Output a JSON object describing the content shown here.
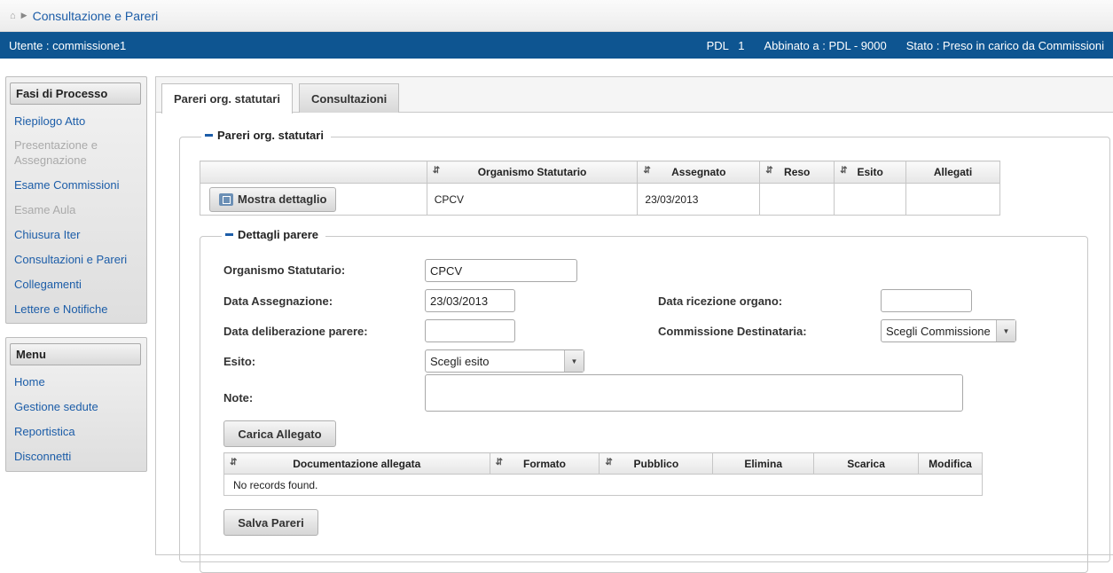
{
  "breadcrumb": {
    "current": "Consultazione e Pareri"
  },
  "userbar": {
    "user": "Utente : commissione1",
    "pdl": "PDL   1",
    "abbinato": "Abbinato a : PDL - 9000",
    "stato": "Stato : Preso in carico da Commissioni"
  },
  "fasi": {
    "title": "Fasi di Processo",
    "items": [
      {
        "label": "Riepilogo Atto"
      },
      {
        "label": "Presentazione e Assegnazione"
      },
      {
        "label": "Esame Commissioni"
      },
      {
        "label": "Esame Aula"
      },
      {
        "label": "Chiusura Iter"
      },
      {
        "label": "Consultazioni e Pareri"
      },
      {
        "label": "Collegamenti"
      },
      {
        "label": "Lettere e Notifiche"
      }
    ]
  },
  "menu": {
    "title": "Menu",
    "items": [
      {
        "label": "Home"
      },
      {
        "label": "Gestione sedute"
      },
      {
        "label": "Reportistica"
      },
      {
        "label": "Disconnetti"
      }
    ]
  },
  "tabs": [
    {
      "label": "Pareri org. statutari"
    },
    {
      "label": "Consultazioni"
    }
  ],
  "pareri": {
    "legend": "Pareri org. statutari",
    "columns": [
      "Organismo Statutario",
      "Assegnato",
      "Reso",
      "Esito",
      "Allegati"
    ],
    "row": {
      "button": "Mostra dettaglio",
      "organismo": "CPCV",
      "assegnato": "23/03/2013",
      "reso": "",
      "esito": "",
      "allegati": ""
    }
  },
  "dettagli": {
    "legend": "Dettagli parere",
    "organismo_label": "Organismo Statutario:",
    "organismo_value": "CPCV",
    "data_assegnazione_label": "Data Assegnazione:",
    "data_assegnazione_value": "23/03/2013",
    "data_ricezione_label": "Data ricezione organo:",
    "data_ricezione_value": "",
    "data_deliberazione_label": "Data deliberazione parere:",
    "data_deliberazione_value": "",
    "commissione_label": "Commissione Destinataria:",
    "commissione_value": "Scegli Commissione",
    "esito_label": "Esito:",
    "esito_value": "Scegli esito",
    "note_label": "Note:",
    "note_value": "",
    "carica_button": "Carica Allegato",
    "doc_columns": [
      "Documentazione allegata",
      "Formato",
      "Pubblico",
      "Elimina",
      "Scarica",
      "Modifica"
    ],
    "no_records": "No records found.",
    "salva_button": "Salva Pareri"
  }
}
